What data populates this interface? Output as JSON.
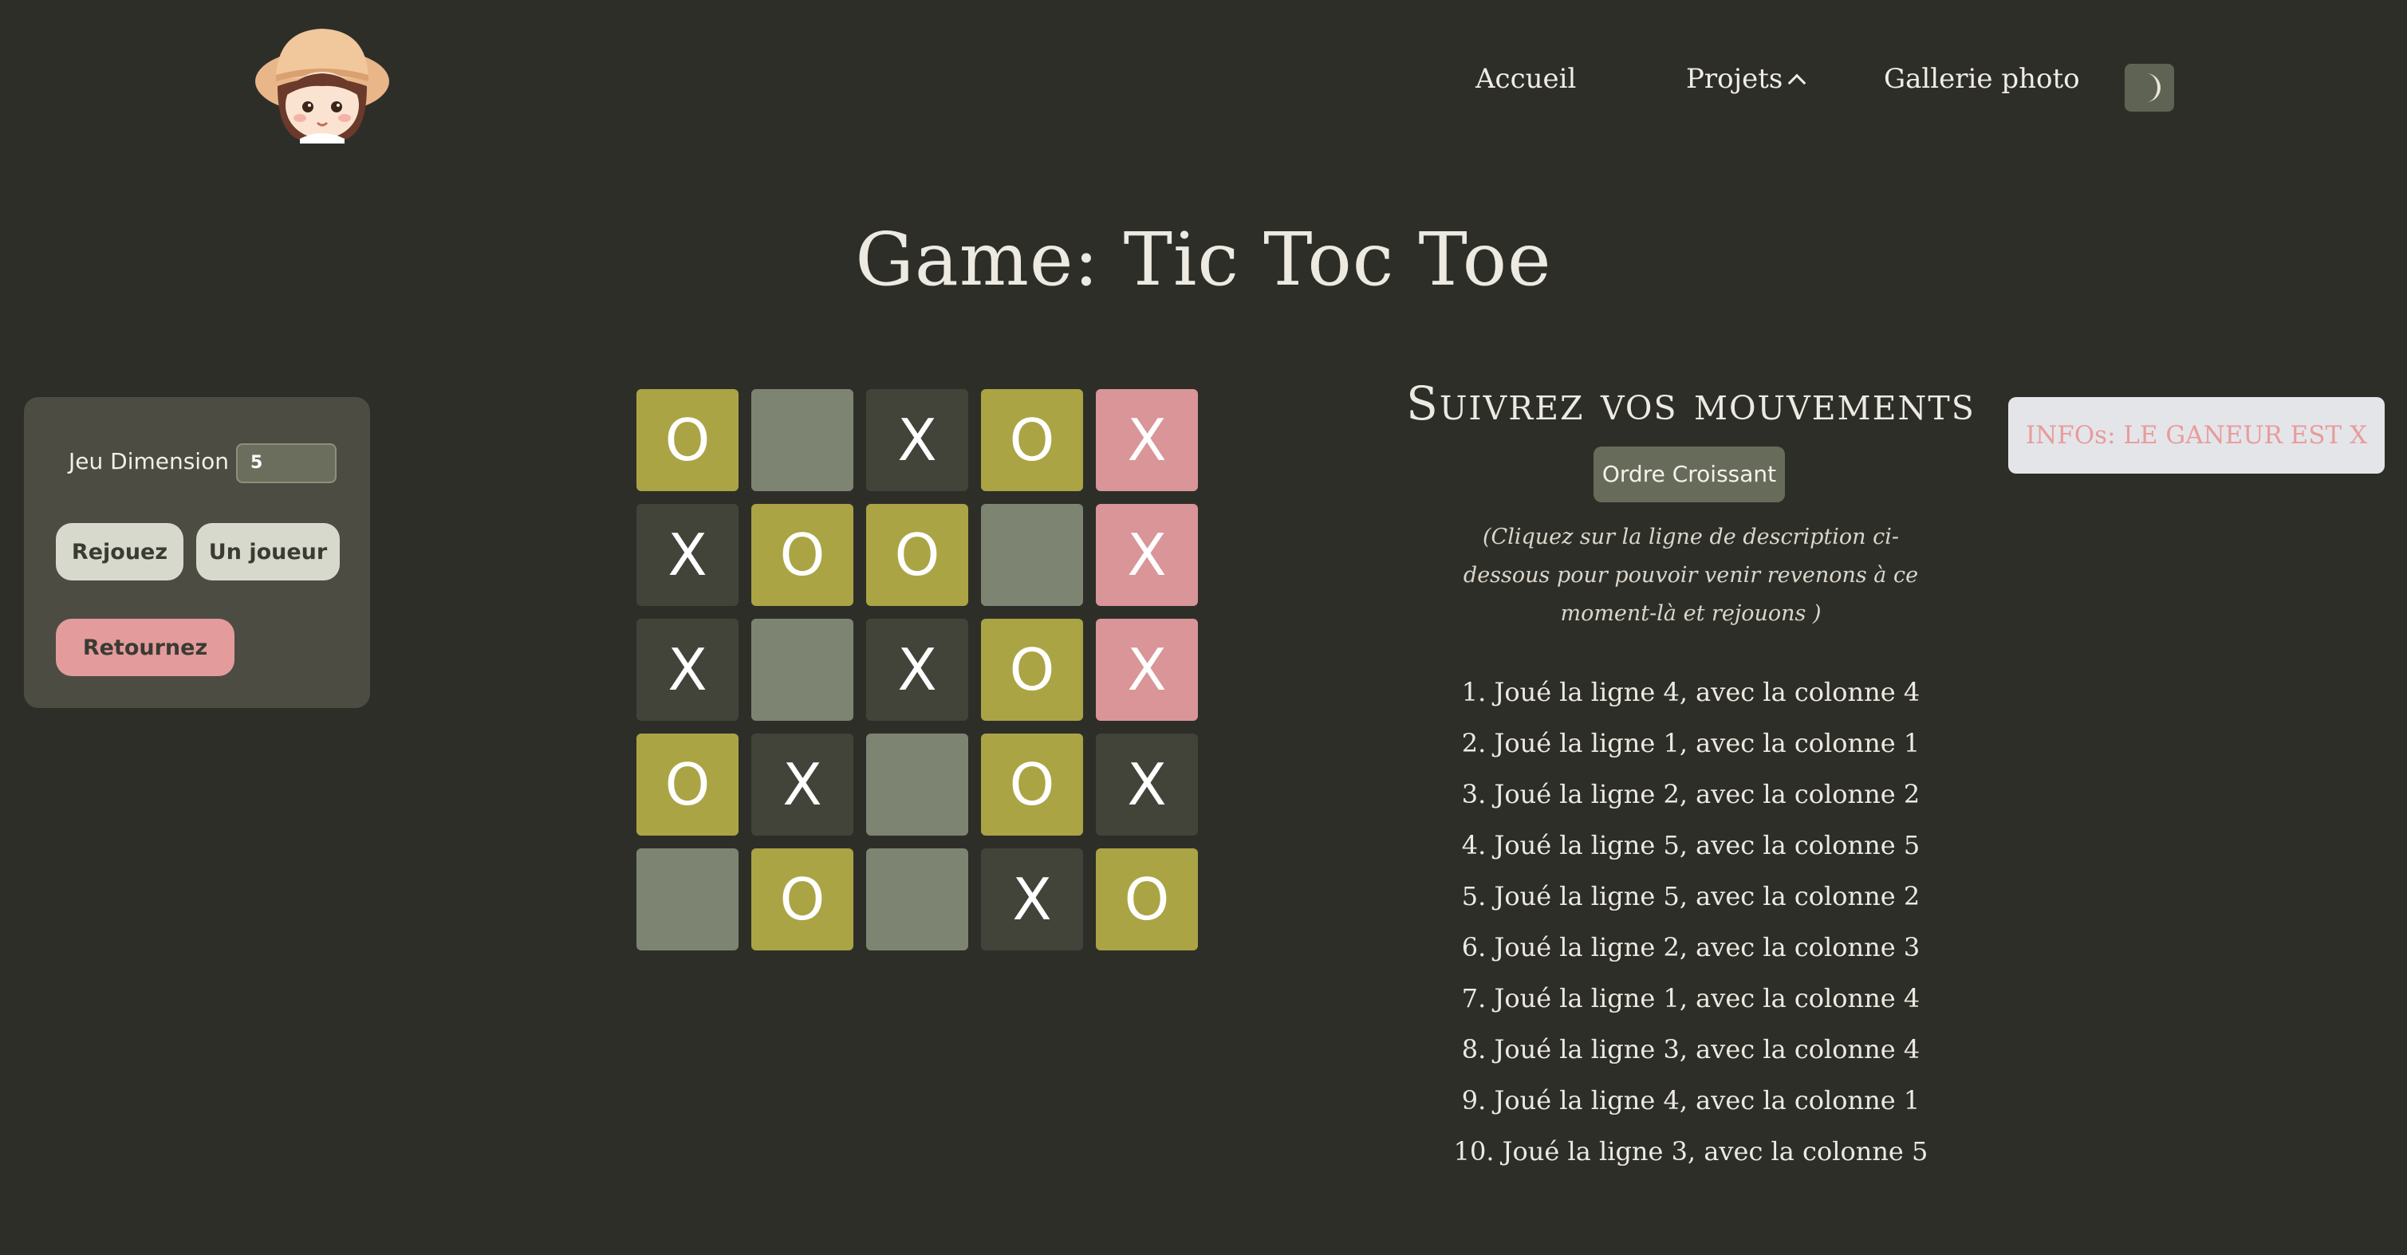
{
  "header": {
    "nav": [
      {
        "label": "Accueil"
      },
      {
        "label": "Projets"
      },
      {
        "label": "Gallerie photo"
      }
    ]
  },
  "page_title": "Game: Tic Toc Toe",
  "controls": {
    "dimension_label": "Jeu Dimension",
    "dimension_value": "5",
    "rejouez_label": "Rejouez",
    "unjoueur_label": "Un joueur",
    "retournez_label": "Retournez"
  },
  "board": {
    "rows": [
      [
        "O",
        "",
        "X",
        "O",
        "X"
      ],
      [
        "X",
        "O",
        "O",
        "",
        "X"
      ],
      [
        "X",
        "",
        "X",
        "O",
        "X"
      ],
      [
        "O",
        "X",
        "",
        "O",
        "X"
      ],
      [
        "",
        "O",
        "",
        "X",
        "O"
      ]
    ],
    "winning_cells": [
      [
        0,
        4
      ],
      [
        1,
        4
      ],
      [
        2,
        4
      ]
    ],
    "colors": {
      "empty": "#7e8472",
      "x": "#42443a",
      "o": "#aba445",
      "win": "#d99597"
    }
  },
  "moves": {
    "title": "Suivrez vos mouvements",
    "order_button": "Ordre Croissant",
    "hint": "(Cliquez sur la ligne de description ci-dessous pour pouvoir venir revenons à ce moment-là et rejouons )",
    "items": [
      "1. Joué la ligne 4, avec la colonne 4",
      "2. Joué la ligne 1, avec la colonne 1",
      "3. Joué la ligne 2, avec la colonne 2",
      "4. Joué la ligne 5, avec la colonne 5",
      "5. Joué la ligne 5, avec la colonne 2",
      "6. Joué la ligne 2, avec la colonne 3",
      "7. Joué la ligne 1, avec la colonne 4",
      "8. Joué la ligne 3, avec la colonne 4",
      "9. Joué la ligne 4, avec la colonne 1",
      "10. Joué la ligne 3, avec la colonne 5"
    ]
  },
  "info": {
    "text": "INFOs: LE GANEUR EST X"
  },
  "icons": {
    "avatar": "girl-avatar",
    "theme_toggle": "moon-icon",
    "projets_chevron": "chevron-up-icon"
  }
}
